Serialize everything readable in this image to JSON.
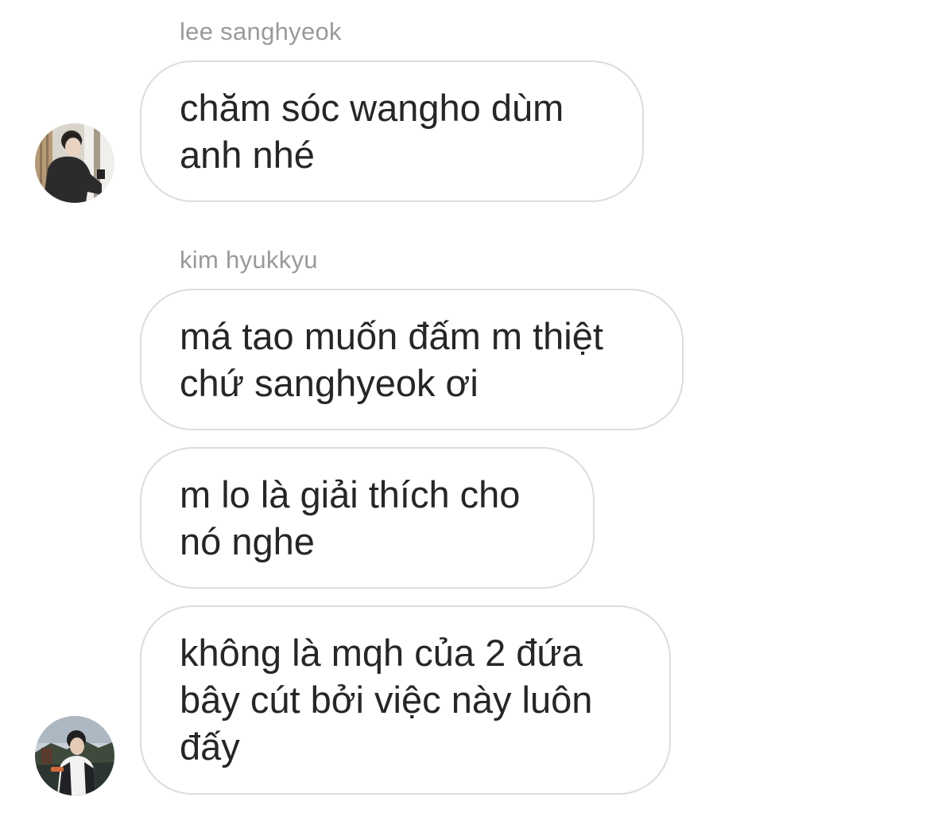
{
  "conversation": {
    "groups": [
      {
        "sender": "lee sanghyeok",
        "avatar_icon": "user-avatar-photo",
        "messages": [
          "chăm sóc wangho dùm\nanh nhé"
        ]
      },
      {
        "sender": "kim hyukkyu",
        "avatar_icon": "user-avatar-photo",
        "messages": [
          "má tao muốn đấm m thiệt\nchứ sanghyeok ơi",
          "m lo là giải thích cho\nnó nghe",
          "không là mqh của 2 đứa\nbây cút bởi việc này luôn\nđấy"
        ]
      }
    ],
    "colors": {
      "background": "#ffffff",
      "bubble_border": "#dcdcdc",
      "message_text": "#262626",
      "sender_text": "#9a9a9a"
    }
  }
}
